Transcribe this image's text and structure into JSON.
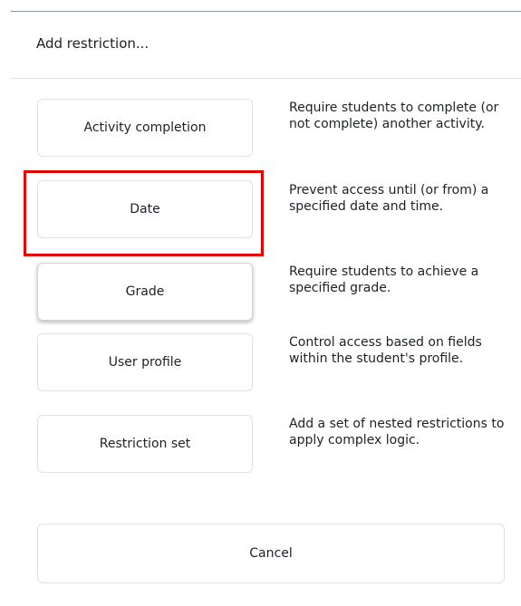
{
  "dialog": {
    "title": "Add restriction...",
    "options": [
      {
        "label": "Activity completion",
        "description": "Require students to complete (or not complete) another activity."
      },
      {
        "label": "Date",
        "description": "Prevent access until (or from) a specified date and time."
      },
      {
        "label": "Grade",
        "description": "Require students to achieve a specified grade."
      },
      {
        "label": "User profile",
        "description": "Control access based on fields within the student's profile."
      },
      {
        "label": "Restriction set",
        "description": "Add a set of nested restrictions to apply complex logic."
      }
    ],
    "cancel_label": "Cancel",
    "highlight_color": "#e00000",
    "border_color": "#dee2e6"
  }
}
